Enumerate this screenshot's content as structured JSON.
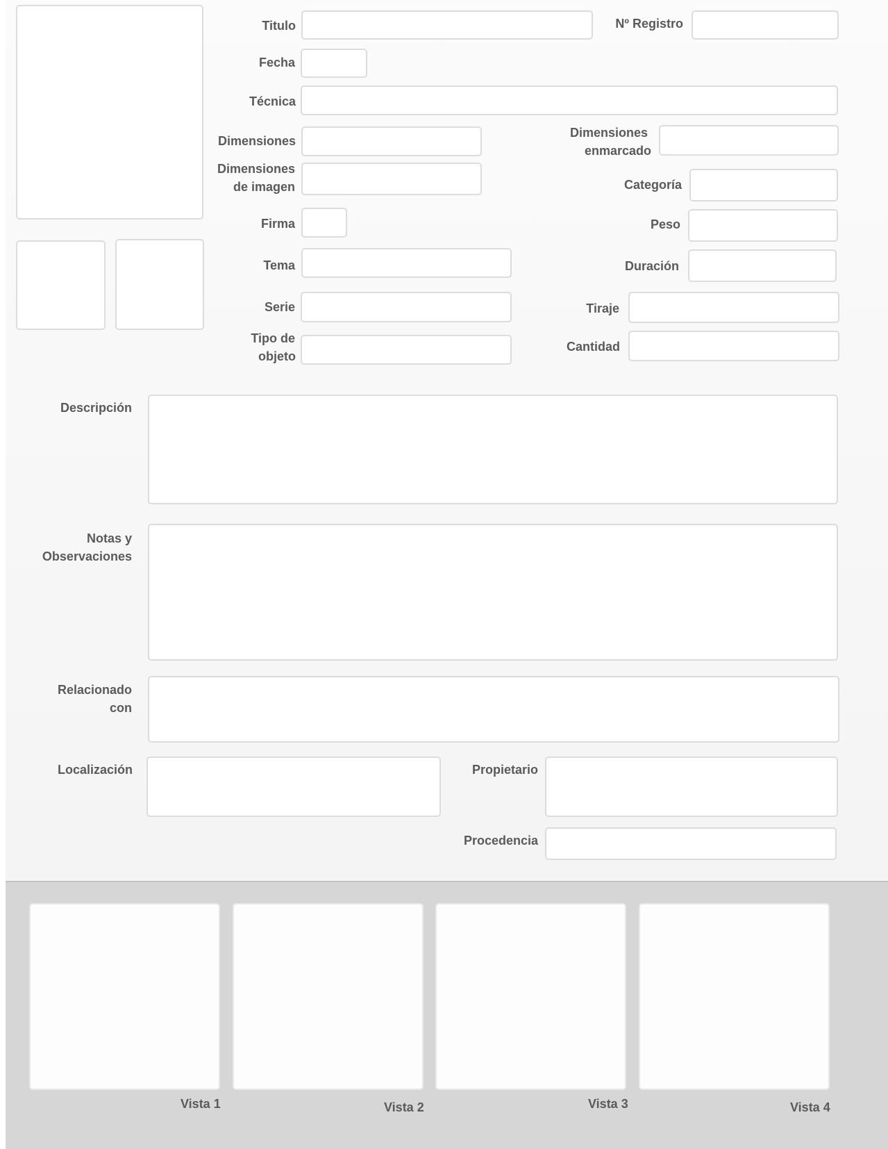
{
  "form": {
    "titulo_label": "Titulo",
    "registro_label": "Nº Registro",
    "fecha_label": "Fecha",
    "tecnica_label": "Técnica",
    "dimensiones_label": "Dimensiones",
    "dimensiones_enmarcado_label_1": "Dimensiones",
    "dimensiones_enmarcado_label_2": "enmarcado",
    "dimensiones_imagen_label_1": "Dimensiones",
    "dimensiones_imagen_label_2": "de imagen",
    "categoria_label": "Categoría",
    "firma_label": "Firma",
    "peso_label": "Peso",
    "tema_label": "Tema",
    "duracion_label": "Duración",
    "serie_label": "Serie",
    "tiraje_label": "Tiraje",
    "tipo_objeto_label_1": "Tipo de",
    "tipo_objeto_label_2": "objeto",
    "cantidad_label": "Cantidad",
    "descripcion_label": "Descripción",
    "notas_label_1": "Notas y",
    "notas_label_2": "Observaciones",
    "relacionado_label_1": "Relacionado",
    "relacionado_label_2": "con",
    "localizacion_label": "Localización",
    "propietario_label": "Propietario",
    "procedencia_label": "Procedencia"
  },
  "gallery": {
    "views": [
      "Vista 1",
      "Vista 2",
      "Vista 3",
      "Vista 4"
    ]
  }
}
